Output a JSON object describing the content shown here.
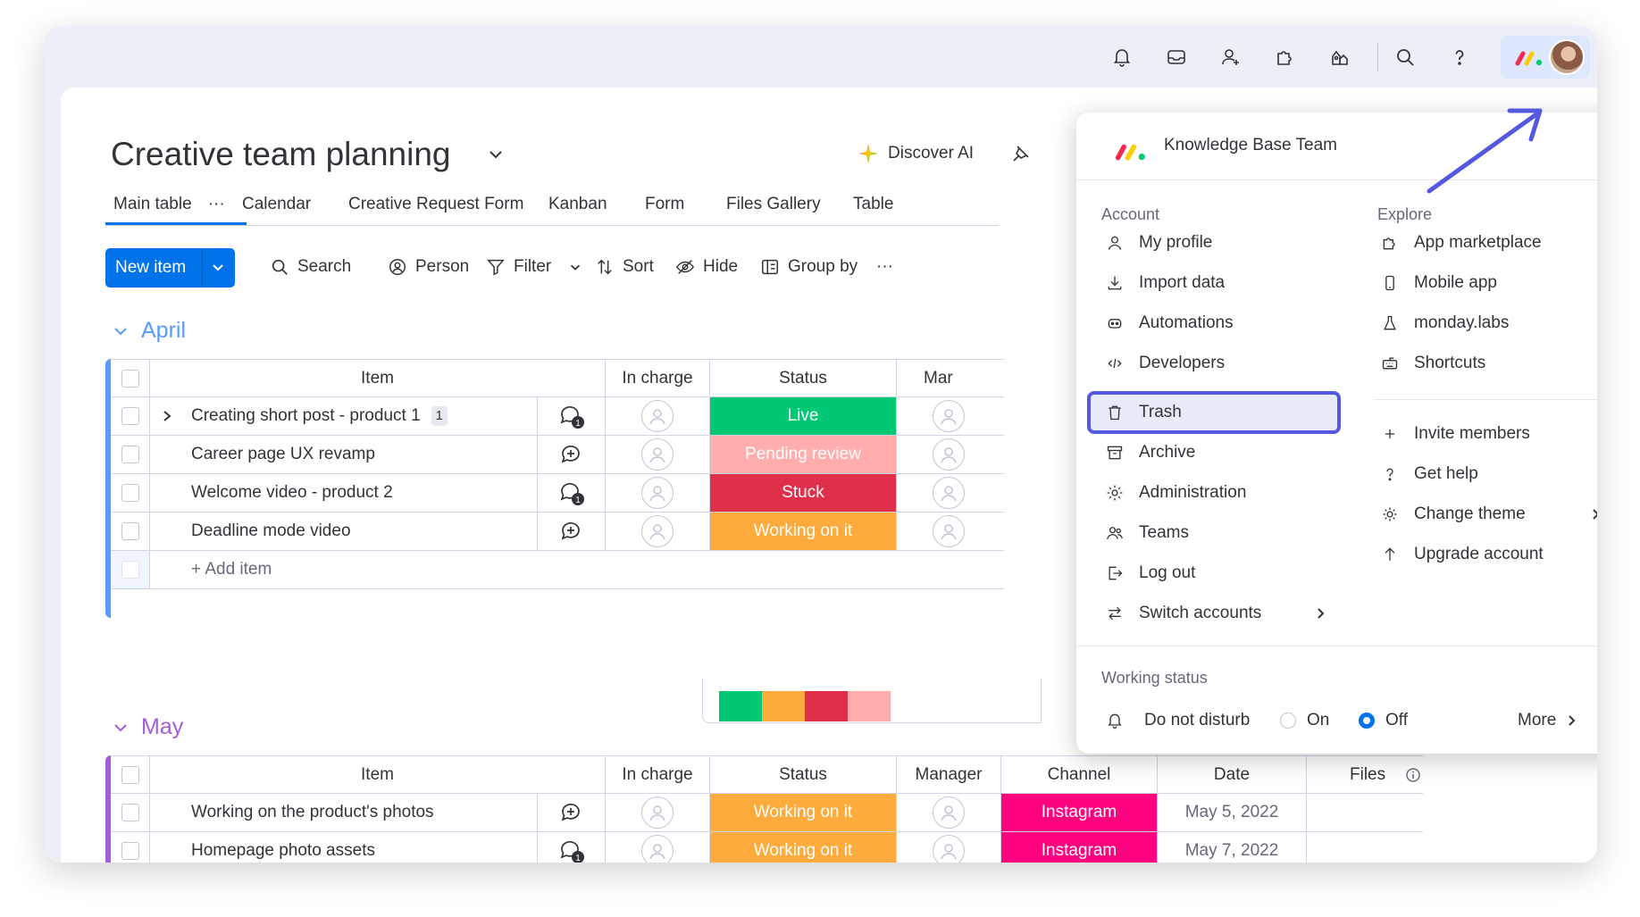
{
  "board": {
    "title": "Creative team planning",
    "discover_label": "Discover AI",
    "tabs": [
      "Main table",
      "Calendar",
      "Creative Request Form",
      "Kanban",
      "Form",
      "Files Gallery",
      "Table"
    ],
    "tab_more": "···",
    "active_tab": "Main table"
  },
  "toolbar": {
    "new_item": "New item",
    "search": "Search",
    "person": "Person",
    "filter": "Filter",
    "sort": "Sort",
    "hide": "Hide",
    "group_by": "Group by",
    "more": "···"
  },
  "groups": {
    "april": {
      "name": "April",
      "color": "#579bfc",
      "columns": [
        "Item",
        "In charge",
        "Status",
        "Mar"
      ],
      "rows": [
        {
          "item": "Creating short post - product 1",
          "subitems": "1",
          "update_count": "1",
          "status": "Live",
          "status_color": "#00c875"
        },
        {
          "item": "Career page UX revamp",
          "update_count": "",
          "status": "Pending review",
          "status_color": "#ffadad"
        },
        {
          "item": "Welcome video - product 2",
          "update_count": "1",
          "status": "Stuck",
          "status_color": "#df2f4a"
        },
        {
          "item": "Deadline mode video",
          "update_count": "",
          "status": "Working on it",
          "status_color": "#fdab3d"
        }
      ],
      "add_item": "+ Add item",
      "status_summary": [
        {
          "color": "#00c875",
          "share": 0.25
        },
        {
          "color": "#fdab3d",
          "share": 0.25
        },
        {
          "color": "#df2f4a",
          "share": 0.25
        },
        {
          "color": "#ffadad",
          "share": 0.25
        }
      ]
    },
    "may": {
      "name": "May",
      "color": "#a25ddc",
      "columns": [
        "Item",
        "In charge",
        "Status",
        "Manager",
        "Channel",
        "Date",
        "Files"
      ],
      "rows": [
        {
          "item": "Working on the product's photos",
          "update_count": "",
          "status": "Working on it",
          "status_color": "#fdab3d",
          "channel": "Instagram",
          "channel_color": "#ff007f",
          "date": "May 5, 2022"
        },
        {
          "item": "Homepage photo assets",
          "update_count": "1",
          "status": "Working on it",
          "status_color": "#fdab3d",
          "channel": "Instagram",
          "channel_color": "#ff007f",
          "date": "May 7, 2022"
        }
      ]
    }
  },
  "menu": {
    "account_name": "Knowledge Base Team",
    "account_title": "Account",
    "explore_title": "Explore",
    "account_items": [
      "My profile",
      "Import data",
      "Automations",
      "Developers",
      "Trash",
      "Archive",
      "Administration",
      "Teams",
      "Log out",
      "Switch accounts"
    ],
    "explore_items": [
      "App marketplace",
      "Mobile app",
      "monday.labs",
      "Shortcuts"
    ],
    "extra_items": [
      "Invite members",
      "Get help",
      "Change theme",
      "Upgrade account"
    ],
    "highlighted": "Trash",
    "highlight_color": "#5559df",
    "working_status_title": "Working status",
    "do_not_disturb": "Do not disturb",
    "on_label": "On",
    "off_label": "Off",
    "dnd_selected": "Off",
    "more_label": "More"
  },
  "topbar_icons": [
    "bell-icon",
    "inbox-icon",
    "invite-icon",
    "apps-icon",
    "marketplace-icon",
    "search-icon",
    "help-icon"
  ]
}
